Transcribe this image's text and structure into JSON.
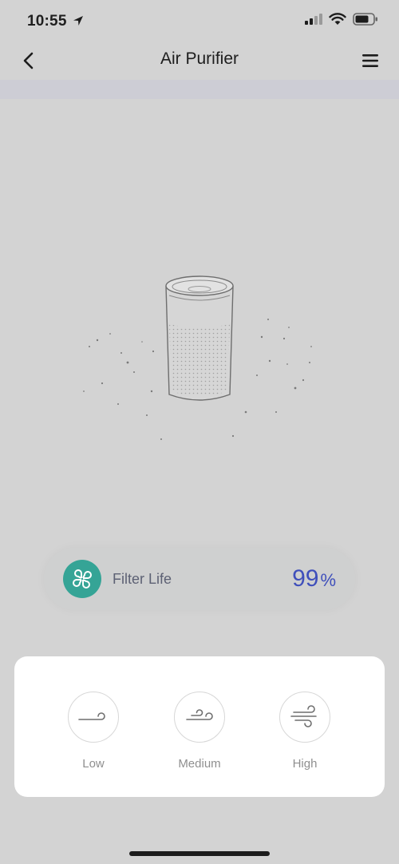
{
  "status": {
    "time": "10:55",
    "location_icon": "location-arrow-icon",
    "signal_icon": "cellular-signal-icon",
    "wifi_icon": "wifi-icon",
    "battery_icon": "battery-icon"
  },
  "nav": {
    "title": "Air Purifier",
    "back_icon": "chevron-left-icon",
    "menu_icon": "hamburger-menu-icon"
  },
  "filter": {
    "label": "Filter Life",
    "value": "99",
    "unit": "%",
    "icon": "filter-clover-icon",
    "accent": "#35a496",
    "value_color": "#3f4fbb"
  },
  "fan_speeds": [
    {
      "label": "Low",
      "icon": "wind-low-icon"
    },
    {
      "label": "Medium",
      "icon": "wind-medium-icon"
    },
    {
      "label": "High",
      "icon": "wind-high-icon"
    }
  ],
  "colors": {
    "background": "#d3d3d3",
    "panel": "#ffffff"
  }
}
